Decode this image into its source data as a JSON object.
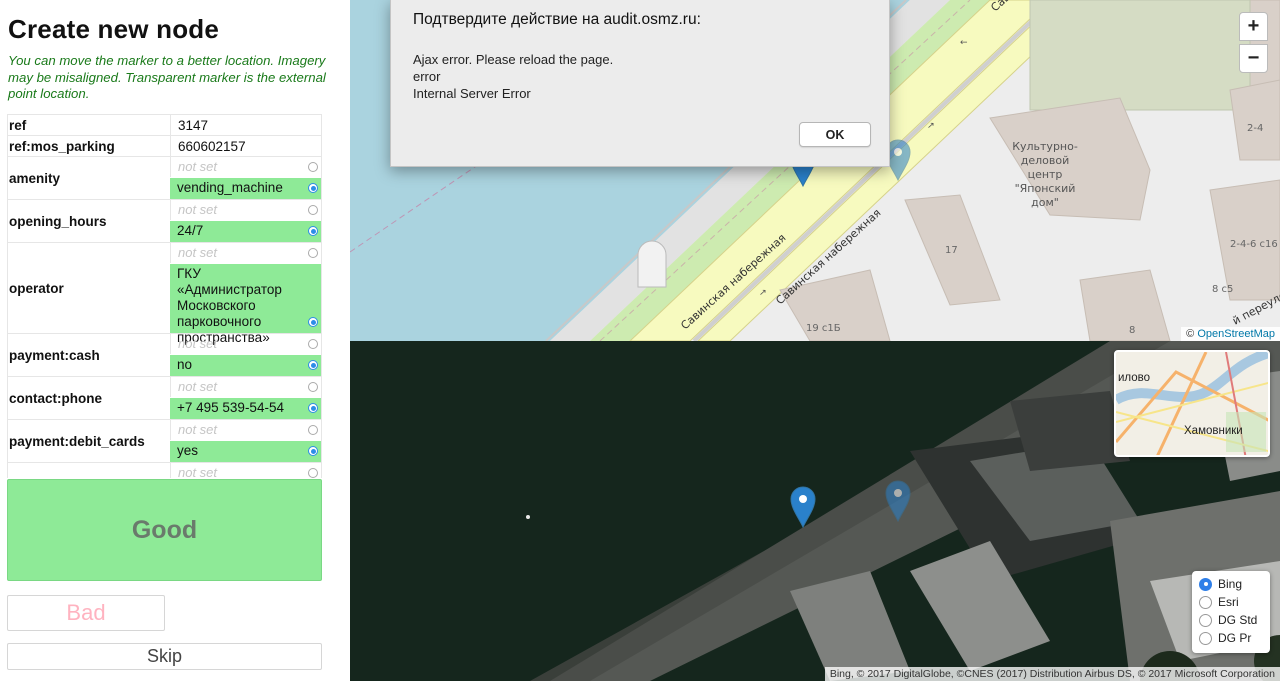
{
  "left_panel": {
    "title": "Create new node",
    "hint": "You can move the marker to a better location. Imagery may be misaligned. Transparent marker is the external point location.",
    "tags": [
      {
        "key": "ref",
        "value": "3147"
      },
      {
        "key": "ref:mos_parking",
        "value": "660602157"
      },
      {
        "key": "amenity",
        "not_set": "not set",
        "value": "vending_machine"
      },
      {
        "key": "opening_hours",
        "not_set": "not set",
        "value": "24/7"
      },
      {
        "key": "operator",
        "not_set": "not set",
        "value": "ГКУ «Администратор Московского парковочного пространства»"
      },
      {
        "key": "payment:cash",
        "not_set": "not set",
        "value": "no"
      },
      {
        "key": "contact:phone",
        "not_set": "not set",
        "value": "+7 495 539-54-54"
      },
      {
        "key": "payment:debit_cards",
        "not_set": "not set",
        "value": "yes"
      },
      {
        "key": "",
        "not_set": "not set",
        "value": ""
      }
    ],
    "good_label": "Good",
    "bad_label": "Bad",
    "skip_label": "Skip"
  },
  "map": {
    "zoom_in": "+",
    "zoom_out": "−",
    "attribution_prefix": "© ",
    "attribution_link": "OpenStreetMap",
    "labels": {
      "street1": "Савинская набережная",
      "street2": "Савинская набережная",
      "street_top": "Сав",
      "building_name": [
        "Культурно-",
        "деловой",
        "центр",
        "\"Японский",
        "дом\""
      ],
      "n17": "17",
      "n19c1b": "19 с1Б",
      "n8": "8",
      "n8c5": "8 с5",
      "n246c16": "2-4-6 с16",
      "n24": "2-4",
      "pereulok": "й переулок"
    }
  },
  "dialog": {
    "title": "Подтвердите действие на audit.osmz.ru:",
    "lines": [
      "Ajax error. Please reload the page.",
      "error",
      "Internal Server Error"
    ],
    "ok_label": "OK"
  },
  "satellite": {
    "minimap_labels": [
      "илово",
      "Хамовники"
    ],
    "layers": [
      {
        "label": "Bing",
        "selected": true
      },
      {
        "label": "Esri",
        "selected": false
      },
      {
        "label": "DG Std",
        "selected": false
      },
      {
        "label": "DG Pr",
        "selected": false
      }
    ],
    "attribution": "Bing, © 2017 DigitalGlobe, ©CNES (2017) Distribution Airbus DS, © 2017 Microsoft Corporation"
  },
  "colors": {
    "accent_green": "#8eea97",
    "hint_green": "#1a7a1a",
    "water": "#aad3df",
    "radio_blue": "#2d8ce8",
    "marker_blue": "#2a81cb"
  },
  "icons": [
    "radio-icon",
    "map-marker-icon",
    "map-marker-transparent-icon",
    "one-way-arrow-icon"
  ]
}
